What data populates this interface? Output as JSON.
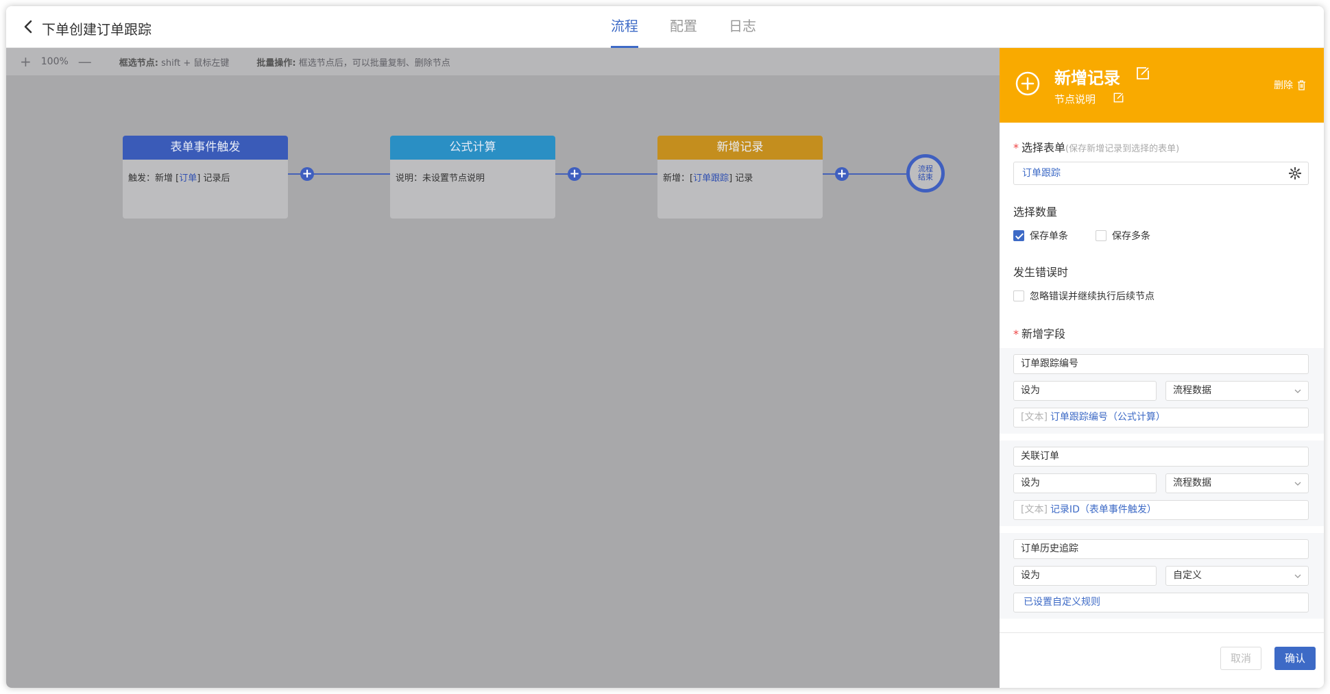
{
  "header": {
    "title": "下单创建订单跟踪",
    "tabs": [
      {
        "label": "流程",
        "active": true
      },
      {
        "label": "配置",
        "active": false
      },
      {
        "label": "日志",
        "active": false
      }
    ]
  },
  "toolbar": {
    "zoom_in": "+",
    "zoom": "100%",
    "zoom_out": "—",
    "hint1_label": "框选节点:",
    "hint1_text": "shift + 鼠标左键",
    "hint2_label": "批量操作:",
    "hint2_text": "框选节点后，可以批量复制、删除节点"
  },
  "flow": {
    "nodes": [
      {
        "title": "表单事件触发",
        "prefix": "触发：新增 [",
        "link": "订单",
        "suffix": "] 记录后",
        "color": "#3a5bb8"
      },
      {
        "title": "公式计算",
        "prefix": "说明：未设置节点说明",
        "link": "",
        "suffix": "",
        "color": "#2a8fc4"
      },
      {
        "title": "新增记录",
        "prefix": "新增：[",
        "link": "订单跟踪",
        "suffix": "] 记录",
        "color": "#c48e1e"
      }
    ],
    "end_line1": "流程",
    "end_line2": "结束",
    "add_symbol": "+"
  },
  "panel": {
    "title": "新增记录",
    "subtitle": "节点说明",
    "delete_label": "删除",
    "accent": "#f9aa00",
    "select_form": {
      "label": "选择表单",
      "hint": "(保存新增记录到选择的表单)",
      "value": "订单跟踪"
    },
    "count": {
      "label": "选择数量",
      "options": [
        {
          "label": "保存单条",
          "checked": true
        },
        {
          "label": "保存多条",
          "checked": false
        }
      ]
    },
    "error": {
      "label": "发生错误时",
      "option": "忽略错误并继续执行后续节点"
    },
    "fields_label": "新增字段",
    "fields": [
      {
        "name": "订单跟踪编号",
        "op": "设为",
        "source": "流程数据",
        "tag": "[文本]",
        "value": "订单跟踪编号（公式计算）"
      },
      {
        "name": "关联订单",
        "op": "设为",
        "source": "流程数据",
        "tag": "[文本]",
        "value": "记录ID（表单事件触发）"
      },
      {
        "name": "订单历史追踪",
        "op": "设为",
        "source": "自定义",
        "tag": "",
        "value": "已设置自定义规则"
      }
    ],
    "cancel_label": "取消",
    "confirm_label": "确认"
  }
}
